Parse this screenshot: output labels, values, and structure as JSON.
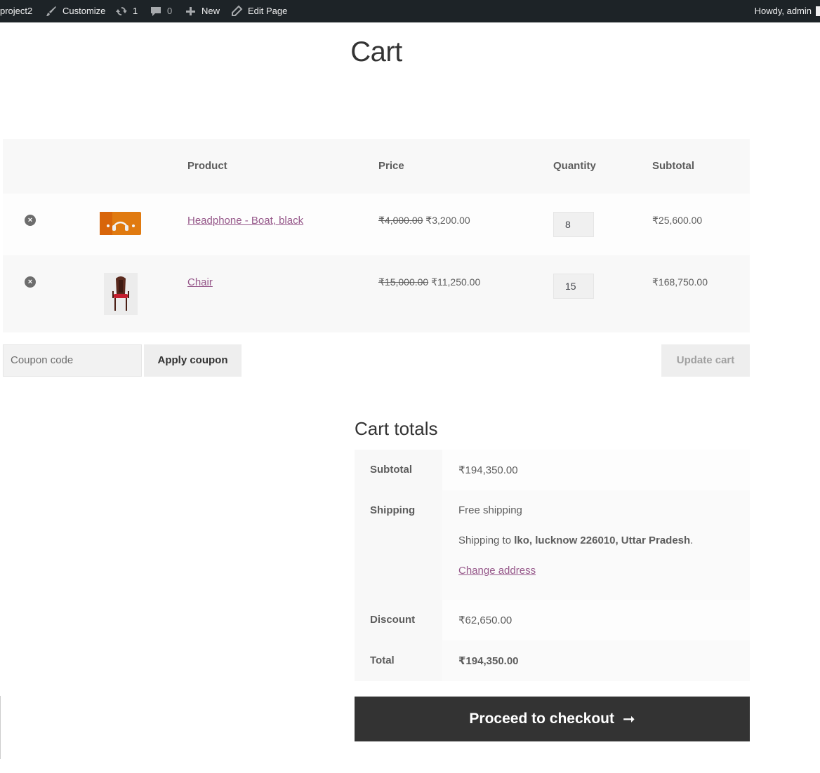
{
  "adminbar": {
    "site_name": "project2",
    "customize": "Customize",
    "updates_count": "1",
    "comments_count": "0",
    "new_label": "New",
    "edit_page": "Edit Page",
    "howdy": "Howdy, admin"
  },
  "page": {
    "title": "Cart"
  },
  "cart": {
    "headers": {
      "product": "Product",
      "price": "Price",
      "quantity": "Quantity",
      "subtotal": "Subtotal"
    },
    "items": [
      {
        "name": "Headphone - Boat, black",
        "regular_price": "₹4,000.00",
        "sale_price": "₹3,200.00",
        "quantity": "8",
        "subtotal": "₹25,600.00"
      },
      {
        "name": "Chair",
        "regular_price": "₹15,000.00",
        "sale_price": "₹11,250.00",
        "quantity": "15",
        "subtotal": "₹168,750.00"
      }
    ],
    "remove_symbol": "×",
    "coupon_placeholder": "Coupon code",
    "apply_coupon": "Apply coupon",
    "update_cart": "Update cart"
  },
  "totals": {
    "title": "Cart totals",
    "subtotal_label": "Subtotal",
    "subtotal_value": "₹194,350.00",
    "shipping_label": "Shipping",
    "shipping_method": "Free shipping",
    "shipping_to_prefix": "Shipping to ",
    "shipping_address": "lko, lucknow 226010, Uttar Pradesh",
    "shipping_to_suffix": ".",
    "change_address": "Change address",
    "discount_label": "Discount",
    "discount_value": "₹62,650.00",
    "total_label": "Total",
    "total_value": "₹194,350.00"
  },
  "checkout": {
    "label": "Proceed to checkout",
    "arrow": "➞"
  },
  "colors": {
    "adminbar_bg": "#1d2327",
    "link": "#96588a",
    "checkout_bg": "#333333",
    "row_alt": "#f8f8f8"
  },
  "icons": [
    "wordpress-site-icon",
    "brush-icon",
    "updates-icon",
    "comment-icon",
    "plus-icon",
    "pencil-icon",
    "remove-icon",
    "arrow-right-icon"
  ]
}
